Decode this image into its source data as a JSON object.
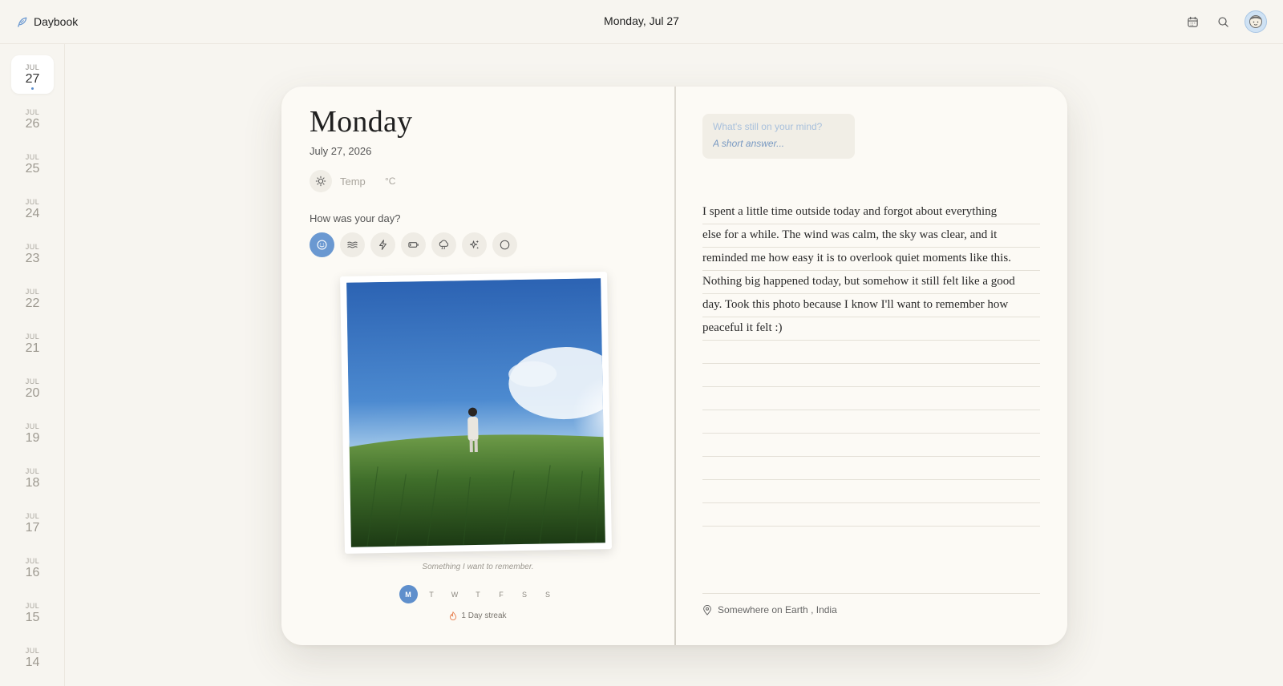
{
  "app": {
    "name": "Daybook",
    "current_date": "Monday, Jul 27"
  },
  "toolbar": {
    "icons": [
      "calendar-icon",
      "search-icon",
      "avatar"
    ]
  },
  "dates": [
    {
      "month": "JUL",
      "day": "27",
      "active": true
    },
    {
      "month": "JUL",
      "day": "26"
    },
    {
      "month": "JUL",
      "day": "25"
    },
    {
      "month": "JUL",
      "day": "24"
    },
    {
      "month": "JUL",
      "day": "23"
    },
    {
      "month": "JUL",
      "day": "22"
    },
    {
      "month": "JUL",
      "day": "21"
    },
    {
      "month": "JUL",
      "day": "20"
    },
    {
      "month": "JUL",
      "day": "19"
    },
    {
      "month": "JUL",
      "day": "18"
    },
    {
      "month": "JUL",
      "day": "17"
    },
    {
      "month": "JUL",
      "day": "16"
    },
    {
      "month": "JUL",
      "day": "15"
    },
    {
      "month": "JUL",
      "day": "14"
    }
  ],
  "entry": {
    "day_name": "Monday",
    "full_date": "July 27, 2026",
    "weather": {
      "temp_placeholder": "Temp",
      "unit": "°C",
      "icon": "sun-icon"
    },
    "mood_label": "How was your day?",
    "moods": [
      {
        "icon": "smile-icon",
        "selected": true
      },
      {
        "icon": "wind-waves-icon"
      },
      {
        "icon": "lightning-icon"
      },
      {
        "icon": "battery-low-icon"
      },
      {
        "icon": "rain-cloud-icon"
      },
      {
        "icon": "sparkles-icon"
      },
      {
        "icon": "circle-icon"
      }
    ],
    "photo_caption": "Something I want to remember.",
    "week_days": [
      "M",
      "T",
      "W",
      "T",
      "F",
      "S",
      "S"
    ],
    "week_active_index": 0,
    "streak": "1 Day streak",
    "prompt_question": "What's still on your mind?",
    "prompt_placeholder": "A short answer...",
    "lines": [
      "I spent a little time outside today and forgot about everything",
      "else for a while. The wind was calm, the sky was clear, and it",
      "reminded me how easy it is to overlook quiet moments like this.",
      "Nothing big happened today, but somehow it still felt like a good",
      "day. Took this photo because I know I'll want to remember how",
      "peaceful it felt :)"
    ],
    "location": "Somewhere on Earth , India"
  },
  "colors": {
    "accent": "#6a98d1",
    "background": "#f7f5f0",
    "page": "#fcfaf5"
  }
}
